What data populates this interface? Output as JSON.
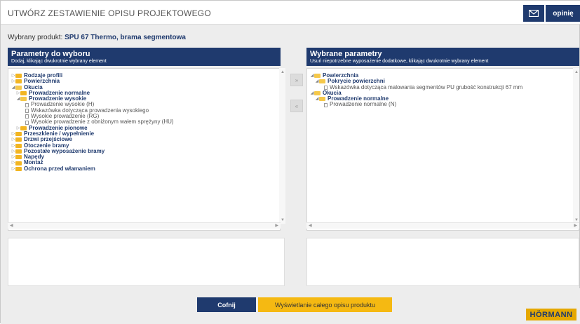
{
  "header": {
    "title": "UTWÓRZ ZESTAWIENIE OPISU PROJEKTOWEGO",
    "mail_icon": "mail-icon",
    "opinion_label": "opinię"
  },
  "product": {
    "label": "Wybrany produkt:",
    "value": "SPU 67 Thermo, brama segmentowa"
  },
  "left_panel": {
    "title": "Parametry do wyboru",
    "subtitle": "Dodaj, klikając dwukrotnie wybrany element",
    "tree": [
      {
        "level": 0,
        "toggle": "▷",
        "type": "folder",
        "label": "Rodzaje profili",
        "bold": true
      },
      {
        "level": 0,
        "toggle": "▷",
        "type": "folder",
        "label": "Powierzchnia",
        "bold": true
      },
      {
        "level": 0,
        "toggle": "◢",
        "type": "folder-open",
        "label": "Okucia",
        "bold": true
      },
      {
        "level": 1,
        "toggle": "▷",
        "type": "folder",
        "label": "Prowadzenie normalne",
        "bold": true
      },
      {
        "level": 1,
        "toggle": "◢",
        "type": "folder-open",
        "label": "Prowadzenie wysokie",
        "bold": true
      },
      {
        "level": 2,
        "toggle": "",
        "type": "doc",
        "label": "Prowadzenie wysokie (H)",
        "bold": false
      },
      {
        "level": 2,
        "toggle": "",
        "type": "doc",
        "label": "Wskazówka dotycząca prowadzenia wysokiego",
        "bold": false
      },
      {
        "level": 2,
        "toggle": "",
        "type": "doc",
        "label": "Wysokie prowadzenie (RG)",
        "bold": false
      },
      {
        "level": 2,
        "toggle": "",
        "type": "doc",
        "label": "Wysokie prowadzenie z obniżonym wałem sprężyny (HU)",
        "bold": false
      },
      {
        "level": 1,
        "toggle": "▷",
        "type": "folder",
        "label": "Prowadzenie pionowe",
        "bold": true
      },
      {
        "level": 0,
        "toggle": "▷",
        "type": "folder",
        "label": "Przeszklenie / wypełnienie",
        "bold": true
      },
      {
        "level": 0,
        "toggle": "▷",
        "type": "folder",
        "label": "Drzwi przejściowe",
        "bold": true
      },
      {
        "level": 0,
        "toggle": "▷",
        "type": "folder",
        "label": "Otoczenie bramy",
        "bold": true
      },
      {
        "level": 0,
        "toggle": "▷",
        "type": "folder",
        "label": "Pozostałe wyposażenie bramy",
        "bold": true
      },
      {
        "level": 0,
        "toggle": "▷",
        "type": "folder",
        "label": "Napędy",
        "bold": true
      },
      {
        "level": 0,
        "toggle": "▷",
        "type": "folder",
        "label": "Montaż",
        "bold": true
      },
      {
        "level": 0,
        "toggle": "▷",
        "type": "folder",
        "label": "Ochrona przed włamaniem",
        "bold": true
      }
    ]
  },
  "right_panel": {
    "title": "Wybrane parametry",
    "subtitle": "Usuń niepotrzebne wyposażenie dodatkowe, klikając dwukrotnie wybrany element",
    "tree": [
      {
        "level": 0,
        "toggle": "◢",
        "type": "folder-open",
        "label": "Powierzchnia",
        "bold": true
      },
      {
        "level": 1,
        "toggle": "◢",
        "type": "folder-open",
        "label": "Pokrycie powierzchni",
        "bold": true
      },
      {
        "level": 2,
        "toggle": "",
        "type": "doc",
        "label": "Wskazówka dotycząca malowania segmentów PU grubość konstrukcji 67 mm",
        "bold": false
      },
      {
        "level": 0,
        "toggle": "◢",
        "type": "folder-open",
        "label": "Okucia",
        "bold": true
      },
      {
        "level": 1,
        "toggle": "◢",
        "type": "folder-open",
        "label": "Prowadzenie normalne",
        "bold": true
      },
      {
        "level": 2,
        "toggle": "",
        "type": "doc",
        "label": "Prowadzenie normalne (N)",
        "bold": false
      }
    ]
  },
  "transfer": {
    "add": "»",
    "remove": "«"
  },
  "actions": {
    "back": "Cofnij",
    "show_full": "Wyświetlanie całego opisu produktu"
  },
  "logo_text": "HÖRMANN",
  "colors": {
    "primary": "#1f3a6e",
    "accent": "#f5b912"
  }
}
